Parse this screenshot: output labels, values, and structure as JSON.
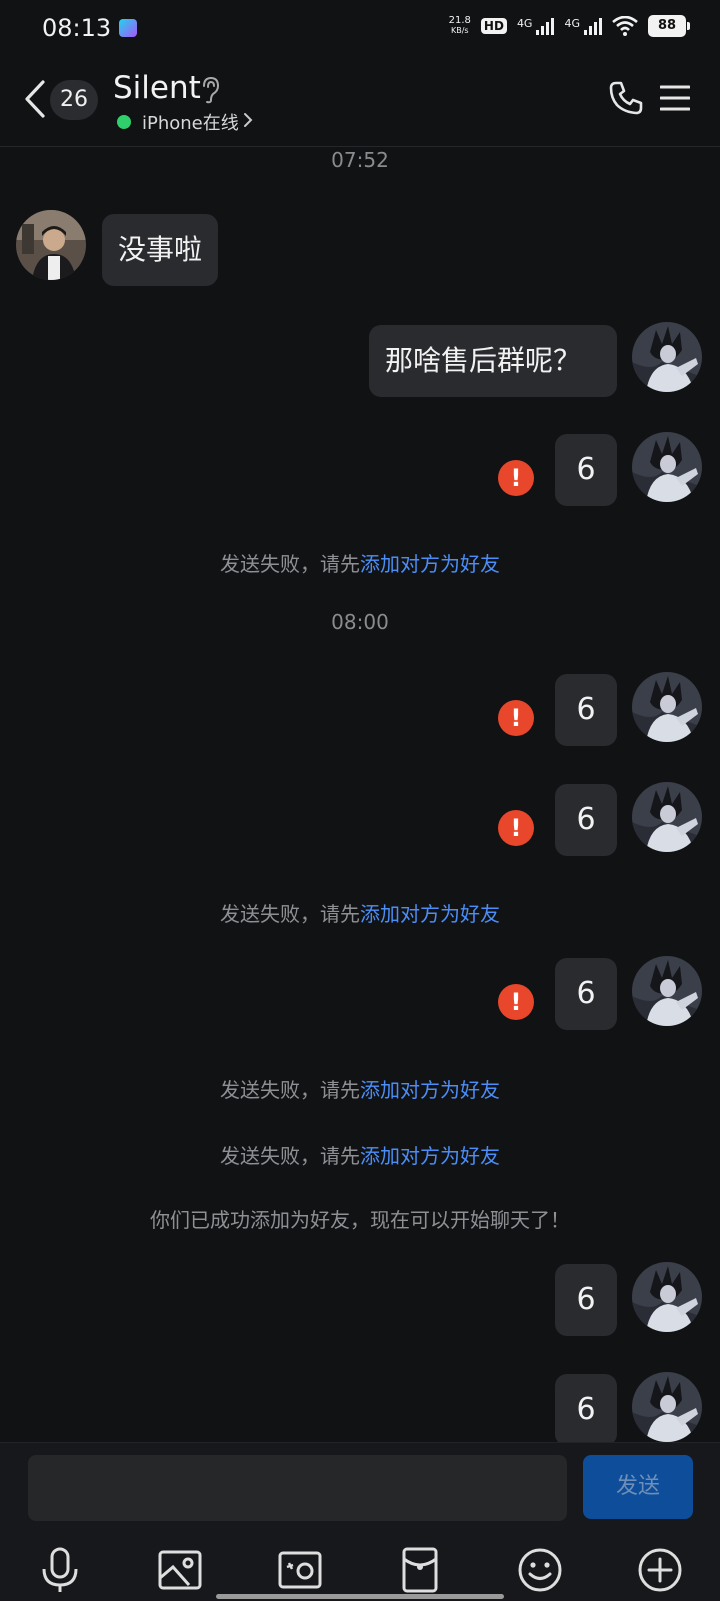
{
  "status_bar": {
    "time": "08:13",
    "net_speed_value": "21.8",
    "net_speed_unit": "KB/s",
    "hd": "HD",
    "sim1": "4G",
    "sim2": "4G",
    "battery": "88"
  },
  "header": {
    "unread_count": "26",
    "contact_name": "Silent",
    "online_status": "iPhone在线"
  },
  "messages": {
    "ts1": "07:52",
    "incoming1": "没事啦",
    "outgoing1": "那啥售后群呢？",
    "outgoing2": "6",
    "sys1_prefix": "发送失败，请先",
    "sys1_link": "添加对方为好友",
    "ts2": "08:00",
    "outgoing3": "6",
    "outgoing4": "6",
    "sys2_prefix": "发送失败，请先",
    "sys2_link": "添加对方为好友",
    "outgoing5": "6",
    "sys3_prefix": "发送失败，请先",
    "sys3_link": "添加对方为好友",
    "sys4_prefix": "发送失败，请先",
    "sys4_link": "添加对方为好友",
    "friend_added": "你们已成功添加为好友，现在可以开始聊天了！",
    "outgoing6": "6",
    "outgoing7": "6",
    "error_mark": "!"
  },
  "input": {
    "send_label": "发送"
  },
  "toolbar": {
    "icons": [
      "mic-icon",
      "image-icon",
      "camera-icon",
      "red-packet-icon",
      "emoji-icon",
      "plus-icon"
    ]
  },
  "colors": {
    "background": "#111214",
    "bubble": "#2a2b2f",
    "link": "#4c8ef7",
    "error": "#e8472b",
    "send_button": "#0d4d99",
    "online": "#2fd06b"
  }
}
